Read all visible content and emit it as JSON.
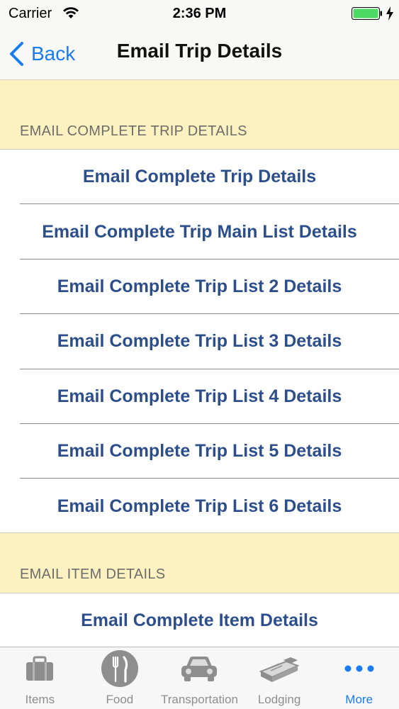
{
  "status_bar": {
    "carrier": "Carrier",
    "time": "2:36 PM"
  },
  "nav": {
    "back_label": "Back",
    "title": "Email Trip Details"
  },
  "sections": [
    {
      "header": "EMAIL COMPLETE TRIP DETAILS",
      "rows": [
        "Email Complete Trip Details",
        "Email Complete Trip Main List Details",
        "Email Complete Trip List 2 Details",
        "Email Complete Trip List 3 Details",
        "Email Complete Trip List 4 Details",
        "Email Complete Trip List 5 Details",
        "Email Complete Trip List 6 Details"
      ]
    },
    {
      "header": "EMAIL ITEM DETAILS",
      "rows": [
        "Email Complete Item Details"
      ]
    }
  ],
  "tab_bar": {
    "tabs": [
      {
        "label": "Items",
        "icon": "briefcase-icon"
      },
      {
        "label": "Food",
        "icon": "fork-knife-icon"
      },
      {
        "label": "Transportation",
        "icon": "car-icon"
      },
      {
        "label": "Lodging",
        "icon": "bed-icon"
      },
      {
        "label": "More",
        "icon": "more-dots-icon",
        "active": true
      }
    ]
  },
  "colors": {
    "accent": "#1a7cf2",
    "row_text": "#2c4f8c",
    "background": "#fcf1c0",
    "battery": "#4cd964"
  }
}
